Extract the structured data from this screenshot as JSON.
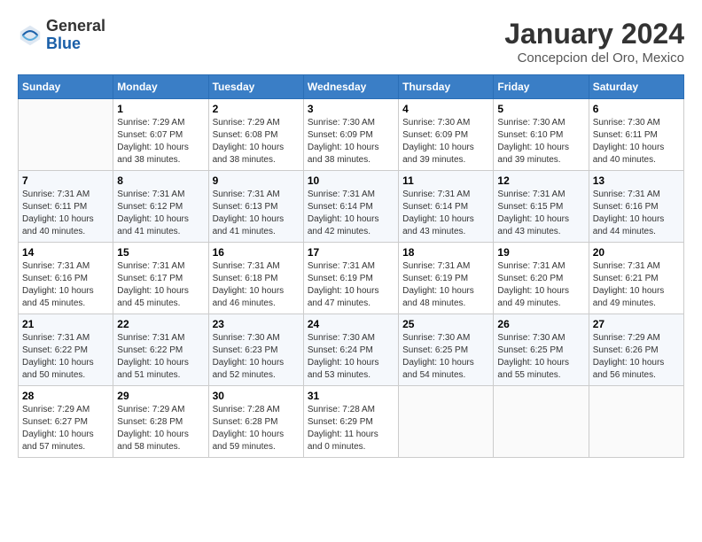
{
  "header": {
    "logo_general": "General",
    "logo_blue": "Blue",
    "title": "January 2024",
    "subtitle": "Concepcion del Oro, Mexico"
  },
  "calendar": {
    "days_of_week": [
      "Sunday",
      "Monday",
      "Tuesday",
      "Wednesday",
      "Thursday",
      "Friday",
      "Saturday"
    ],
    "weeks": [
      [
        {
          "day": "",
          "sunrise": "",
          "sunset": "",
          "daylight": ""
        },
        {
          "day": "1",
          "sunrise": "Sunrise: 7:29 AM",
          "sunset": "Sunset: 6:07 PM",
          "daylight": "Daylight: 10 hours and 38 minutes."
        },
        {
          "day": "2",
          "sunrise": "Sunrise: 7:29 AM",
          "sunset": "Sunset: 6:08 PM",
          "daylight": "Daylight: 10 hours and 38 minutes."
        },
        {
          "day": "3",
          "sunrise": "Sunrise: 7:30 AM",
          "sunset": "Sunset: 6:09 PM",
          "daylight": "Daylight: 10 hours and 38 minutes."
        },
        {
          "day": "4",
          "sunrise": "Sunrise: 7:30 AM",
          "sunset": "Sunset: 6:09 PM",
          "daylight": "Daylight: 10 hours and 39 minutes."
        },
        {
          "day": "5",
          "sunrise": "Sunrise: 7:30 AM",
          "sunset": "Sunset: 6:10 PM",
          "daylight": "Daylight: 10 hours and 39 minutes."
        },
        {
          "day": "6",
          "sunrise": "Sunrise: 7:30 AM",
          "sunset": "Sunset: 6:11 PM",
          "daylight": "Daylight: 10 hours and 40 minutes."
        }
      ],
      [
        {
          "day": "7",
          "sunrise": "Sunrise: 7:31 AM",
          "sunset": "Sunset: 6:11 PM",
          "daylight": "Daylight: 10 hours and 40 minutes."
        },
        {
          "day": "8",
          "sunrise": "Sunrise: 7:31 AM",
          "sunset": "Sunset: 6:12 PM",
          "daylight": "Daylight: 10 hours and 41 minutes."
        },
        {
          "day": "9",
          "sunrise": "Sunrise: 7:31 AM",
          "sunset": "Sunset: 6:13 PM",
          "daylight": "Daylight: 10 hours and 41 minutes."
        },
        {
          "day": "10",
          "sunrise": "Sunrise: 7:31 AM",
          "sunset": "Sunset: 6:14 PM",
          "daylight": "Daylight: 10 hours and 42 minutes."
        },
        {
          "day": "11",
          "sunrise": "Sunrise: 7:31 AM",
          "sunset": "Sunset: 6:14 PM",
          "daylight": "Daylight: 10 hours and 43 minutes."
        },
        {
          "day": "12",
          "sunrise": "Sunrise: 7:31 AM",
          "sunset": "Sunset: 6:15 PM",
          "daylight": "Daylight: 10 hours and 43 minutes."
        },
        {
          "day": "13",
          "sunrise": "Sunrise: 7:31 AM",
          "sunset": "Sunset: 6:16 PM",
          "daylight": "Daylight: 10 hours and 44 minutes."
        }
      ],
      [
        {
          "day": "14",
          "sunrise": "Sunrise: 7:31 AM",
          "sunset": "Sunset: 6:16 PM",
          "daylight": "Daylight: 10 hours and 45 minutes."
        },
        {
          "day": "15",
          "sunrise": "Sunrise: 7:31 AM",
          "sunset": "Sunset: 6:17 PM",
          "daylight": "Daylight: 10 hours and 45 minutes."
        },
        {
          "day": "16",
          "sunrise": "Sunrise: 7:31 AM",
          "sunset": "Sunset: 6:18 PM",
          "daylight": "Daylight: 10 hours and 46 minutes."
        },
        {
          "day": "17",
          "sunrise": "Sunrise: 7:31 AM",
          "sunset": "Sunset: 6:19 PM",
          "daylight": "Daylight: 10 hours and 47 minutes."
        },
        {
          "day": "18",
          "sunrise": "Sunrise: 7:31 AM",
          "sunset": "Sunset: 6:19 PM",
          "daylight": "Daylight: 10 hours and 48 minutes."
        },
        {
          "day": "19",
          "sunrise": "Sunrise: 7:31 AM",
          "sunset": "Sunset: 6:20 PM",
          "daylight": "Daylight: 10 hours and 49 minutes."
        },
        {
          "day": "20",
          "sunrise": "Sunrise: 7:31 AM",
          "sunset": "Sunset: 6:21 PM",
          "daylight": "Daylight: 10 hours and 49 minutes."
        }
      ],
      [
        {
          "day": "21",
          "sunrise": "Sunrise: 7:31 AM",
          "sunset": "Sunset: 6:22 PM",
          "daylight": "Daylight: 10 hours and 50 minutes."
        },
        {
          "day": "22",
          "sunrise": "Sunrise: 7:31 AM",
          "sunset": "Sunset: 6:22 PM",
          "daylight": "Daylight: 10 hours and 51 minutes."
        },
        {
          "day": "23",
          "sunrise": "Sunrise: 7:30 AM",
          "sunset": "Sunset: 6:23 PM",
          "daylight": "Daylight: 10 hours and 52 minutes."
        },
        {
          "day": "24",
          "sunrise": "Sunrise: 7:30 AM",
          "sunset": "Sunset: 6:24 PM",
          "daylight": "Daylight: 10 hours and 53 minutes."
        },
        {
          "day": "25",
          "sunrise": "Sunrise: 7:30 AM",
          "sunset": "Sunset: 6:25 PM",
          "daylight": "Daylight: 10 hours and 54 minutes."
        },
        {
          "day": "26",
          "sunrise": "Sunrise: 7:30 AM",
          "sunset": "Sunset: 6:25 PM",
          "daylight": "Daylight: 10 hours and 55 minutes."
        },
        {
          "day": "27",
          "sunrise": "Sunrise: 7:29 AM",
          "sunset": "Sunset: 6:26 PM",
          "daylight": "Daylight: 10 hours and 56 minutes."
        }
      ],
      [
        {
          "day": "28",
          "sunrise": "Sunrise: 7:29 AM",
          "sunset": "Sunset: 6:27 PM",
          "daylight": "Daylight: 10 hours and 57 minutes."
        },
        {
          "day": "29",
          "sunrise": "Sunrise: 7:29 AM",
          "sunset": "Sunset: 6:28 PM",
          "daylight": "Daylight: 10 hours and 58 minutes."
        },
        {
          "day": "30",
          "sunrise": "Sunrise: 7:28 AM",
          "sunset": "Sunset: 6:28 PM",
          "daylight": "Daylight: 10 hours and 59 minutes."
        },
        {
          "day": "31",
          "sunrise": "Sunrise: 7:28 AM",
          "sunset": "Sunset: 6:29 PM",
          "daylight": "Daylight: 11 hours and 0 minutes."
        },
        {
          "day": "",
          "sunrise": "",
          "sunset": "",
          "daylight": ""
        },
        {
          "day": "",
          "sunrise": "",
          "sunset": "",
          "daylight": ""
        },
        {
          "day": "",
          "sunrise": "",
          "sunset": "",
          "daylight": ""
        }
      ]
    ]
  }
}
